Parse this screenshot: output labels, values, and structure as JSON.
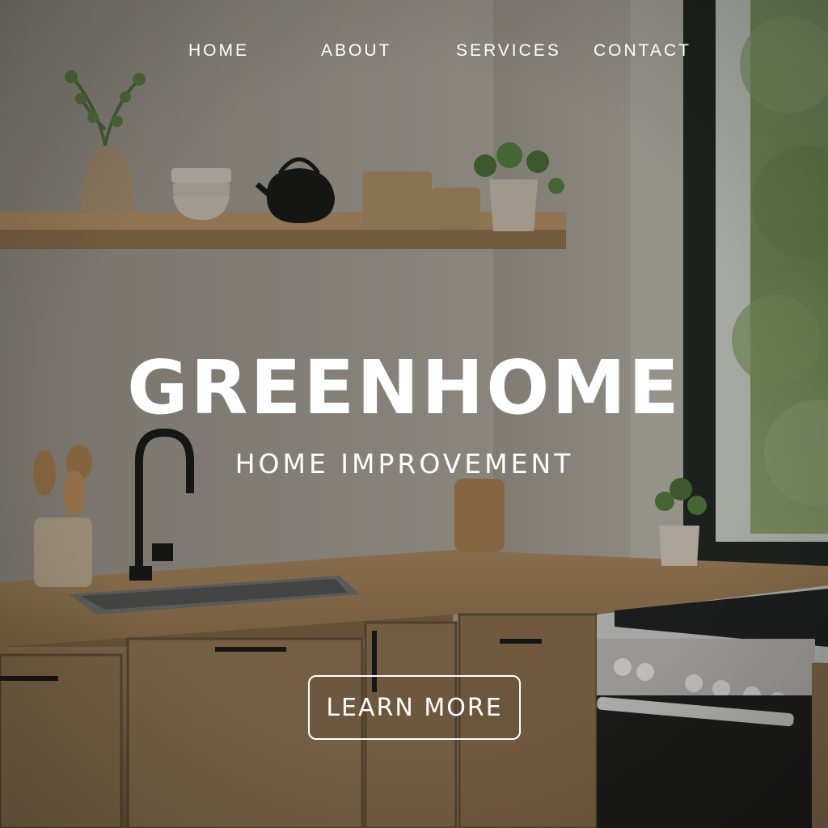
{
  "nav": {
    "items": [
      {
        "label": "HOME"
      },
      {
        "label": "ABOUT"
      },
      {
        "label": "SERVICES"
      },
      {
        "label": "CONTACT"
      }
    ]
  },
  "hero": {
    "title": "GREENHOME",
    "subtitle": "HOME IMPROVEMENT",
    "cta_label": "LEARN MORE"
  },
  "colors": {
    "text": "#ffffff",
    "wall": "#a29d94",
    "wood": "#b8956a",
    "window_frame": "#1f2420",
    "foliage": "#7a9a5c"
  }
}
